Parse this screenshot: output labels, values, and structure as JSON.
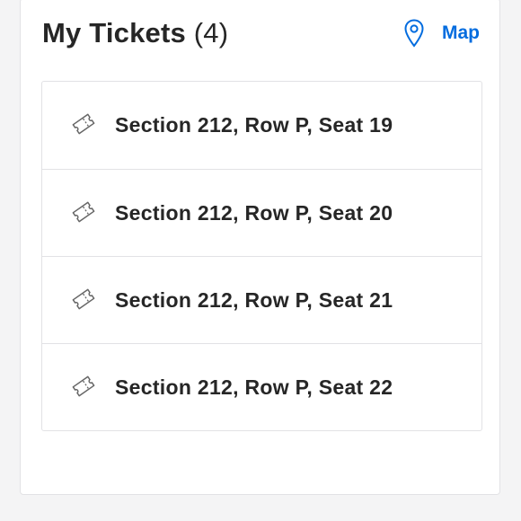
{
  "header": {
    "title": "My Tickets",
    "count": "(4)",
    "map_label": "Map",
    "map_icon": "location-pin-icon"
  },
  "tickets": [
    {
      "label": "Section 212, Row P, Seat 19",
      "icon": "ticket-icon"
    },
    {
      "label": "Section 212, Row P, Seat 20",
      "icon": "ticket-icon"
    },
    {
      "label": "Section 212, Row P, Seat 21",
      "icon": "ticket-icon"
    },
    {
      "label": "Section 212, Row P, Seat 22",
      "icon": "ticket-icon"
    }
  ],
  "colors": {
    "accent": "#026cdf",
    "text": "#262626",
    "border": "#e2e2e5"
  }
}
